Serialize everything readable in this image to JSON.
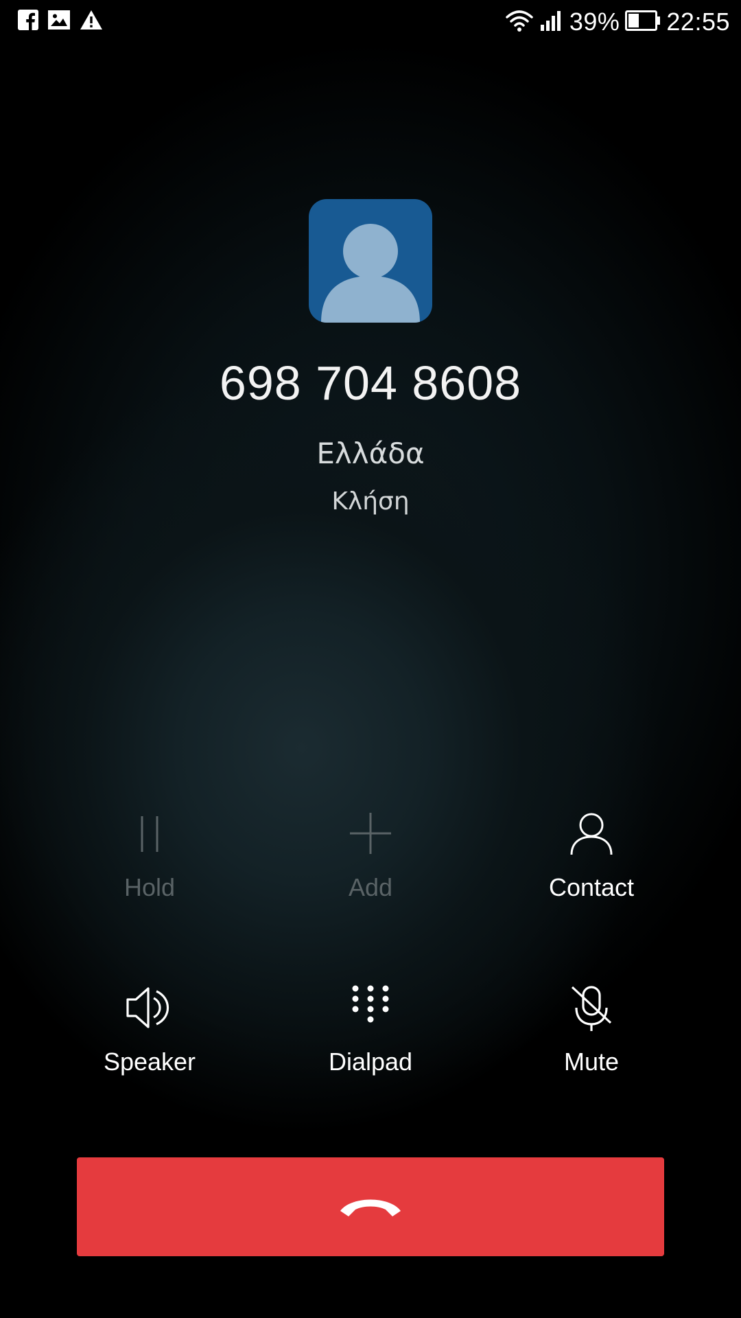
{
  "status_bar": {
    "left_icons": [
      "facebook-icon",
      "gallery-icon",
      "warning-icon"
    ],
    "battery_percent": "39%",
    "time": "22:55"
  },
  "call": {
    "number": "698 704 8608",
    "location": "Ελλάδα",
    "status": "Κλήση"
  },
  "actions": {
    "hold": {
      "label": "Hold",
      "icon": "pause-icon",
      "enabled": false
    },
    "add": {
      "label": "Add",
      "icon": "plus-icon",
      "enabled": false
    },
    "contact": {
      "label": "Contact",
      "icon": "person-icon",
      "enabled": true
    },
    "speaker": {
      "label": "Speaker",
      "icon": "speaker-icon",
      "enabled": true
    },
    "dialpad": {
      "label": "Dialpad",
      "icon": "dialpad-icon",
      "enabled": true
    },
    "mute": {
      "label": "Mute",
      "icon": "mic-off-icon",
      "enabled": true
    }
  },
  "colors": {
    "hangup": "#e53b3e",
    "avatar_bg": "#185a93",
    "avatar_fg": "#8fb2cf",
    "disabled": "#5a6366"
  }
}
